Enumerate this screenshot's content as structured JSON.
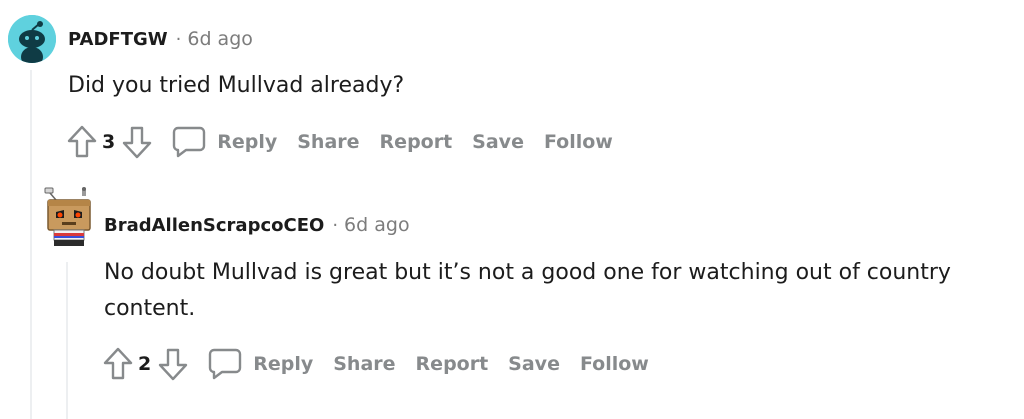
{
  "comments": [
    {
      "username": "PADFTGW",
      "separator": "·",
      "time": "6d ago",
      "body": "Did you tried Mullvad already?",
      "votes": "3",
      "actions": {
        "reply": "Reply",
        "share": "Share",
        "report": "Report",
        "save": "Save",
        "follow": "Follow"
      },
      "avatar_color": "#5fd1de"
    },
    {
      "username": "BradAllenScrapcoCEO",
      "separator": "·",
      "time": "6d ago",
      "body": "No doubt Mullvad is great but it’s not a good one for watching out of country content.",
      "votes": "2",
      "actions": {
        "reply": "Reply",
        "share": "Share",
        "report": "Report",
        "save": "Save",
        "follow": "Follow"
      }
    }
  ],
  "colors": {
    "text": "#1c1c1c",
    "muted": "#7c7c7c",
    "action": "#878a8c",
    "thread_line": "#edeff1"
  }
}
